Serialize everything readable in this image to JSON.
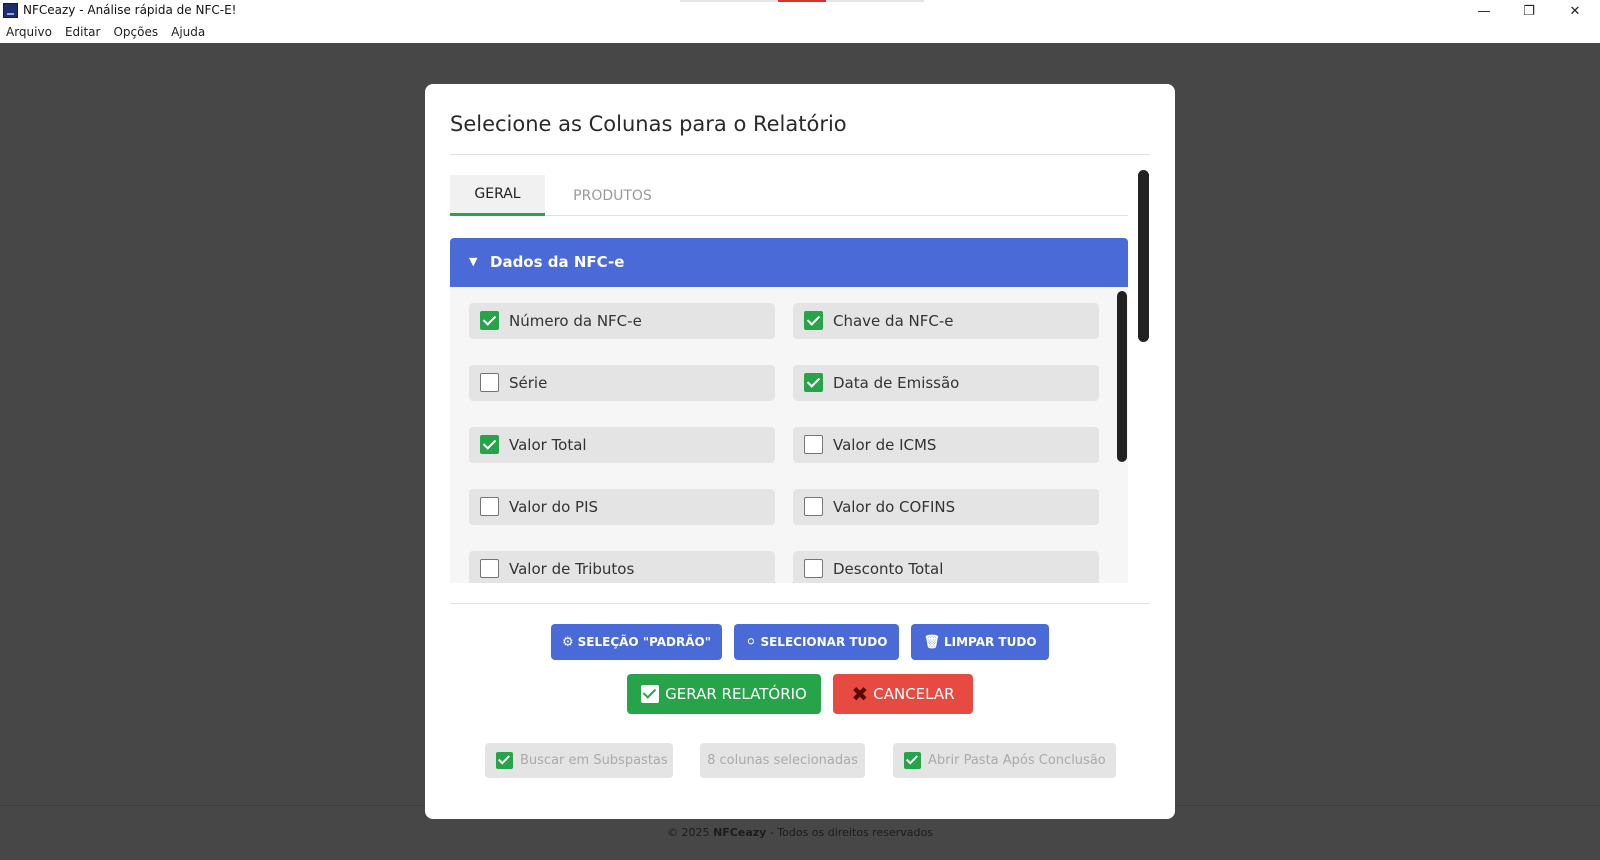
{
  "window": {
    "title": "NFCeazy - Análise rápida de NFC-E!",
    "minimize_glyph": "—",
    "maximize_glyph": "❐",
    "close_glyph": "✕"
  },
  "menu": [
    "Arquivo",
    "Editar",
    "Opções",
    "Ajuda"
  ],
  "dialog": {
    "title": "Selecione as Colunas para o Relatório",
    "tabs": [
      {
        "label": "GERAL",
        "active": true
      },
      {
        "label": "PRODUTOS",
        "active": false
      }
    ],
    "section": {
      "arrow": "▼",
      "title": "Dados da NFC-e"
    },
    "options": [
      {
        "label": "Número da NFC-e",
        "checked": true
      },
      {
        "label": "Chave da NFC-e",
        "checked": true
      },
      {
        "label": "Série",
        "checked": false
      },
      {
        "label": "Data de Emissão",
        "checked": true
      },
      {
        "label": "Valor Total",
        "checked": true
      },
      {
        "label": "Valor de ICMS",
        "checked": false
      },
      {
        "label": "Valor do PIS",
        "checked": false
      },
      {
        "label": "Valor do COFINS",
        "checked": false
      },
      {
        "label": "Valor de Tributos",
        "checked": false
      },
      {
        "label": "Desconto Total",
        "checked": false
      }
    ],
    "buttons": {
      "default_selection": "SELEÇÃO \"PADRÃO\"",
      "select_all": "SELECIONAR TUDO",
      "clear_all": "LIMPAR TUDO",
      "generate": "GERAR RELATÓRIO",
      "cancel": "CANCELAR"
    },
    "icons": {
      "gear": "⚙",
      "circle": "⚪",
      "trash": "🗑",
      "x": "✖"
    },
    "bottom": {
      "search_subfolders": {
        "label": "Buscar em Subspastas",
        "checked": true
      },
      "selected_count": "8 colunas selecionadas",
      "open_folder": {
        "label": "Abrir Pasta Após Conclusão",
        "checked": true
      }
    }
  },
  "footer": {
    "prefix": "© 2025 ",
    "brand": "NFCeazy",
    "suffix": " - Todos os direitos reservados"
  },
  "colors": {
    "accent_blue": "#4a6ad7",
    "accent_green": "#27a44a",
    "accent_red": "#e64a41",
    "background": "#474747"
  }
}
